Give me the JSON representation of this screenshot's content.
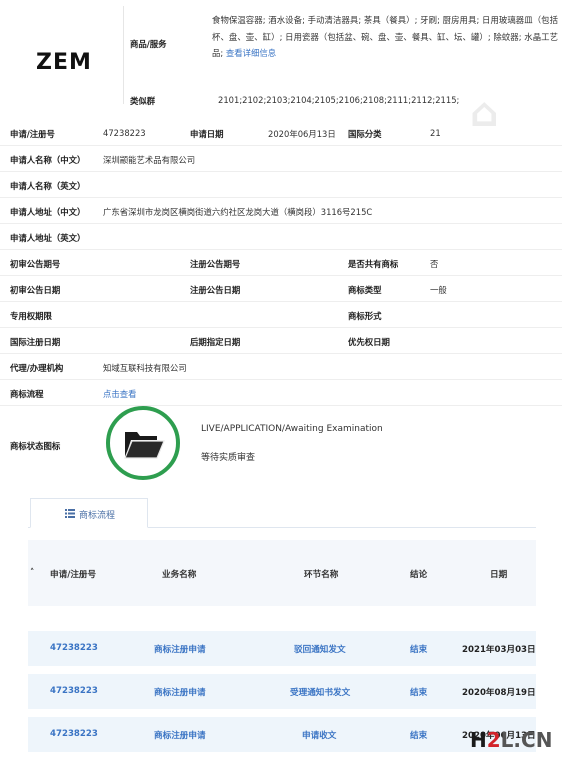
{
  "header": {
    "logo_text": "ZEM",
    "goods_label": "商品/服务",
    "goods_text": "食物保温容器; 酒水设备; 手动清洁器具; 茶具（餐具）; 牙刷; 厨房用具; 日用玻璃器皿（包括杯、盘、壶、缸）; 日用瓷器（包括盆、碗、盘、壶、餐具、缸、坛、罐）; 除蚊器; 水晶工艺品;",
    "goods_link": "查看详细信息",
    "similar_label": "类似群",
    "similar_text": "2101;2102;2103;2104;2105;2106;2108;2111;2112;2115;"
  },
  "rows": {
    "reg_no_label": "申请/注册号",
    "reg_no_value": "47238223",
    "apply_date_label": "申请日期",
    "apply_date_value": "2020年06月13日",
    "intl_class_label": "国际分类",
    "intl_class_value": "21",
    "applicant_cn_label": "申请人名称（中文）",
    "applicant_cn_value": "深圳颛能艺术品有限公司",
    "applicant_en_label": "申请人名称（英文）",
    "address_cn_label": "申请人地址（中文）",
    "address_cn_value": "广东省深圳市龙岗区横岗街道六约社区龙岗大道（横岗段）3116号215C",
    "address_en_label": "申请人地址（英文）",
    "prelim_no_label": "初审公告期号",
    "reg_pub_no_label": "注册公告期号",
    "shared_label": "是否共有商标",
    "shared_value": "否",
    "prelim_date_label": "初审公告日期",
    "reg_pub_date_label": "注册公告日期",
    "mark_type_label": "商标类型",
    "mark_type_value": "一般",
    "exclusive_label": "专用权期限",
    "mark_form_label": "商标形式",
    "intl_reg_date_label": "国际注册日期",
    "later_date_label": "后期指定日期",
    "priority_date_label": "优先权日期",
    "agent_label": "代理/办理机构",
    "agent_value": "知域互联科技有限公司",
    "flow_label": "商标流程",
    "flow_link": "点击查看",
    "status_icon_label": "商标状态图标",
    "status_en": "LIVE/APPLICATION/Awaiting Examination",
    "status_cn": "等待实质审查"
  },
  "flow_panel": {
    "tab_label": "商标流程",
    "columns": [
      "申请/注册号",
      "业务名称",
      "环节名称",
      "结论",
      "日期"
    ],
    "rows": [
      {
        "reg_no": "47238223",
        "business": "商标注册申请",
        "step": "驳回通知发文",
        "result": "结束",
        "date": "2021年03月03日"
      },
      {
        "reg_no": "47238223",
        "business": "商标注册申请",
        "step": "受理通知书发文",
        "result": "结束",
        "date": "2020年08月19日"
      },
      {
        "reg_no": "47238223",
        "business": "商标注册申请",
        "step": "申请收文",
        "result": "结束",
        "date": "2020年06月13日"
      }
    ]
  },
  "watermark": {
    "part1": "H",
    "part2": "2",
    "part3": "L.CN"
  },
  "colors": {
    "link": "#3a74c4",
    "status_ring": "#2e9e4f",
    "row_bg": "#eef5fb",
    "watermark_red": "#d2232a"
  }
}
